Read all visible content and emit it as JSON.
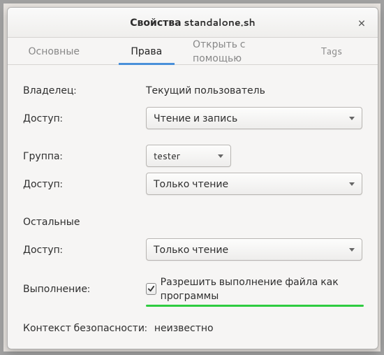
{
  "titlebar": {
    "title": "Свойства standalone.sh"
  },
  "tabs": {
    "basic": {
      "label": "Основные"
    },
    "perms": {
      "label": "Права"
    },
    "open": {
      "label": "Открыть с помощью"
    },
    "tags": {
      "label": "Tags"
    }
  },
  "labels": {
    "owner": "Владелец:",
    "access": "Доступ:",
    "group": "Группа:",
    "others": "Остальные",
    "execute": "Выполнение:",
    "secctx": "Контекст безопасности:"
  },
  "values": {
    "owner": "Текущий пользователь",
    "owner_access": "Чтение и запись",
    "group": "tester",
    "group_access": "Только чтение",
    "others_access": "Только чтение",
    "execute_label": "Разрешить выполнение файла как программы",
    "execute_checked": true,
    "secctx": "неизвестно"
  },
  "colors": {
    "accent_tab": "#4a90d9",
    "underline": "#2ecc40"
  }
}
